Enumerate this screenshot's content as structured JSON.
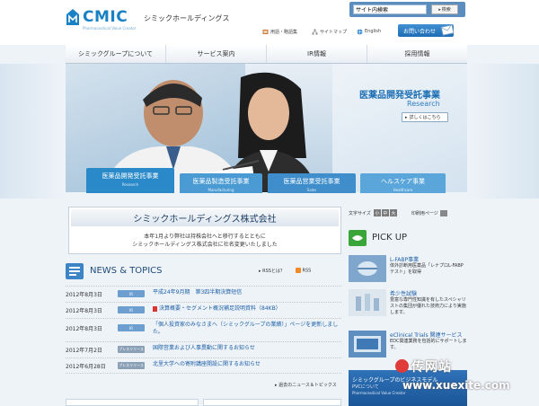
{
  "header": {
    "logo_text": "CMIC",
    "logo_sub": "Pharmaceutical Value Creator",
    "brand_name": "シミックホールディングス",
    "search_placeholder": "サイト内検索",
    "search_button": "検索",
    "utility": [
      {
        "icon": "book-icon",
        "label": "用語・略語集"
      },
      {
        "icon": "sitemap-icon",
        "label": "サイトマップ"
      },
      {
        "icon": "globe-icon",
        "label": "English"
      }
    ],
    "contact_label": "お問い合わせ"
  },
  "nav": [
    "シミックグループについて",
    "サービス案内",
    "IR情報",
    "採用情報"
  ],
  "hero": {
    "title": "医薬品開発受託事業",
    "subtitle": "Research",
    "more_label": "詳しくはこちら",
    "tabs": [
      {
        "jp": "医薬品開発受託事業",
        "en": "Research",
        "color": "#2a8ac9"
      },
      {
        "jp": "医薬品製造受託事業",
        "en": "Manufacturing",
        "color": "#4a9bd3"
      },
      {
        "jp": "医薬品営業受託事業",
        "en": "Sales",
        "color": "#3f8ecb"
      },
      {
        "jp": "ヘルスケア事業",
        "en": "Healthcare",
        "color": "#5aa6da"
      }
    ]
  },
  "notice": {
    "heading": "シミックホールディングス株式会社",
    "line1": "本年1月より弊社は持株会社へと移行するとともに",
    "line2": "シミックホールディングス株式会社に社名変更いたしました"
  },
  "news": {
    "title": "NEWS & TOPICS",
    "rss_what": "RSSとは？",
    "rss": "RSS",
    "more": "過去のニュース＆トピックス",
    "items": [
      {
        "date": "2012年8月3日",
        "cat": "IR",
        "cat_color": "#6c9fd0",
        "text": "平成24年9月期　第3四半期決算短信"
      },
      {
        "date": "2012年8月3日",
        "cat": "IR",
        "cat_color": "#6c9fd0",
        "text": "決算概要・セグメント概況補足説明資料（84KB）"
      },
      {
        "date": "2012年8月3日",
        "cat": "IR",
        "cat_color": "#6c9fd0",
        "text": "「個人投資家のみなさまへ（シミックグループの業績）」ページを更新しました。"
      },
      {
        "date": "2012年7月2日",
        "cat": "プレスリリース",
        "cat_color": "#8aa0b6",
        "text": "国際営業および人事異動に関するお知らせ"
      },
      {
        "date": "2012年6月28日",
        "cat": "プレスリリース",
        "cat_color": "#8aa0b6",
        "text": "北里大学への寄附講座開設に関するお知らせ"
      }
    ]
  },
  "fontbar": {
    "label": "文字サイズ",
    "small": "小",
    "medium": "中",
    "large": "大",
    "print": "印刷用ページ"
  },
  "pickup": {
    "title": "PICK UP",
    "items": [
      {
        "title": "L-FABP事業",
        "desc": "体外診断用医薬品「レナプロL-FABPテスト」を取得"
      },
      {
        "title": "希少性試験",
        "desc": "豊富な専門性知識を有したスペシャリストの集団が優れた技術力により実施します。"
      },
      {
        "title": "eClinical Trials 関連サービス",
        "desc": "EDC関連業務を包括的にサポートします。"
      }
    ],
    "banner_title": "シミックグループのビジネスモデル",
    "banner_sub": "PVCについて",
    "banner_en": "Pharmaceutical Value Creator"
  },
  "watermark": {
    "cn": "传网站",
    "url": "www.xuexite.com"
  }
}
